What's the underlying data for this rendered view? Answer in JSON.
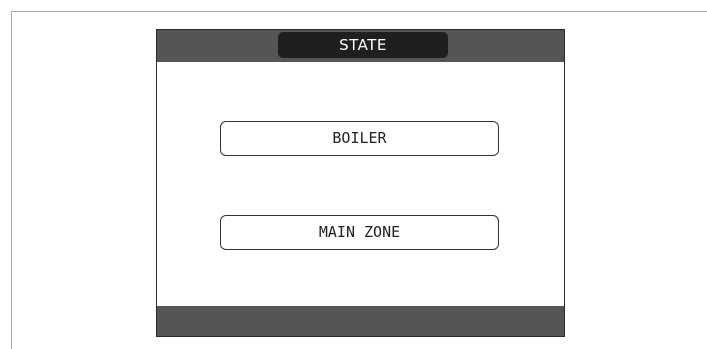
{
  "header": {
    "title": "STATE"
  },
  "menu": {
    "items": [
      {
        "label": "BOILER"
      },
      {
        "label": "MAIN ZONE"
      }
    ]
  },
  "colors": {
    "bar": "#555555",
    "title_pill": "#1f1f1f",
    "title_text": "#ffffff",
    "button_border": "#333333",
    "background": "#ffffff"
  }
}
